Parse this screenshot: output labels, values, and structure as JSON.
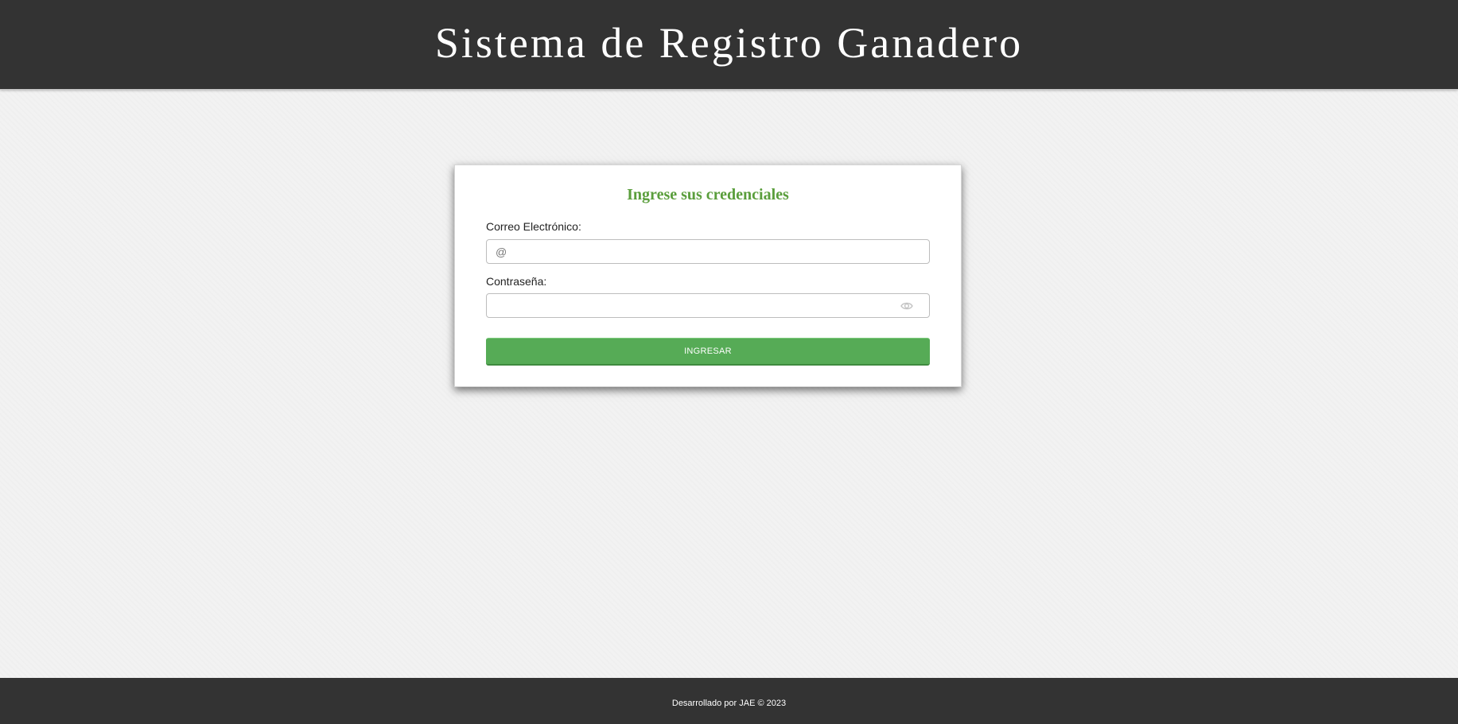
{
  "header": {
    "title": "Sistema de Registro Ganadero"
  },
  "login": {
    "heading": "Ingrese sus credenciales",
    "email_label": "Correo Electrónico:",
    "email_placeholder": "@",
    "email_value": "",
    "password_label": "Contraseña:",
    "password_placeholder": "",
    "password_value": "",
    "password_toggle_icon": "eye-icon",
    "submit_label": "INGRESAR"
  },
  "footer": {
    "text": "Desarrollado por JAE © 2023"
  },
  "colors": {
    "header_bg": "#333333",
    "page_bg": "#f2f2f2",
    "heading": "#5a9e3c",
    "button": "#56ab56",
    "footer_bg": "#333333"
  }
}
